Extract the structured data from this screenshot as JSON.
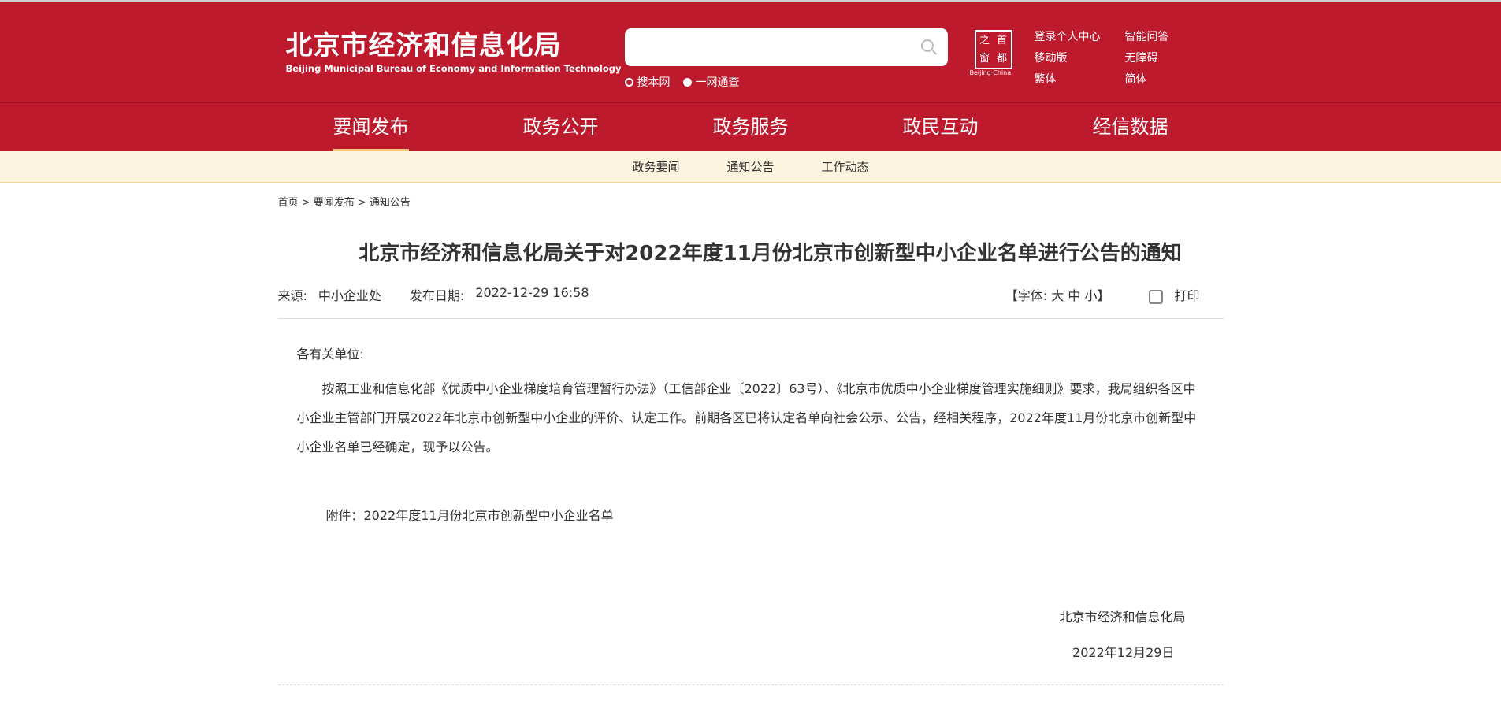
{
  "header": {
    "site_name": "北京市经济和信息化局",
    "site_name_en": "Beijing Municipal Bureau of Economy and Information Technology",
    "search": {
      "placeholder": "",
      "scope_options": [
        "搜本网",
        "一网通查"
      ],
      "selected": "一网通查"
    },
    "badge": {
      "chars": [
        "之",
        "首",
        "窗",
        "都"
      ],
      "caption": "Beijing·China"
    },
    "links": [
      "登录个人中心",
      "智能问答",
      "移动版",
      "无障碍",
      "繁体",
      "简体"
    ]
  },
  "nav": {
    "items": [
      "要闻发布",
      "政务公开",
      "政务服务",
      "政民互动",
      "经信数据"
    ],
    "active": "要闻发布"
  },
  "subnav": {
    "items": [
      "政务要闻",
      "通知公告",
      "工作动态"
    ]
  },
  "breadcrumb": [
    "首页",
    "要闻发布",
    "通知公告"
  ],
  "article": {
    "title": "北京市经济和信息化局关于对2022年度11月份北京市创新型中小企业名单进行公告的通知",
    "source_label": "来源:",
    "source": "中小企业处",
    "date_label": "发布日期:",
    "date": "2022-12-29 16:58",
    "font_label": "【字体:",
    "font_sizes": [
      "大",
      "中",
      "小"
    ],
    "font_close": "】",
    "print": "打印",
    "greeting": "各有关单位:",
    "paragraph": "按照工业和信息化部《优质中小企业梯度培育管理暂行办法》（工信部企业〔2022〕63号）、《北京市优质中小企业梯度管理实施细则》要求，我局组织各区中小企业主管部门开展2022年北京市创新型中小企业的评价、认定工作。前期各区已将认定名单向社会公示、公告，经相关程序，2022年度11月份北京市创新型中小企业名单已经确定，现予以公告。",
    "attachment": "附件：2022年度11月份北京市创新型中小企业名单",
    "signature": "北京市经济和信息化局",
    "sign_date": "2022年12月29日"
  }
}
